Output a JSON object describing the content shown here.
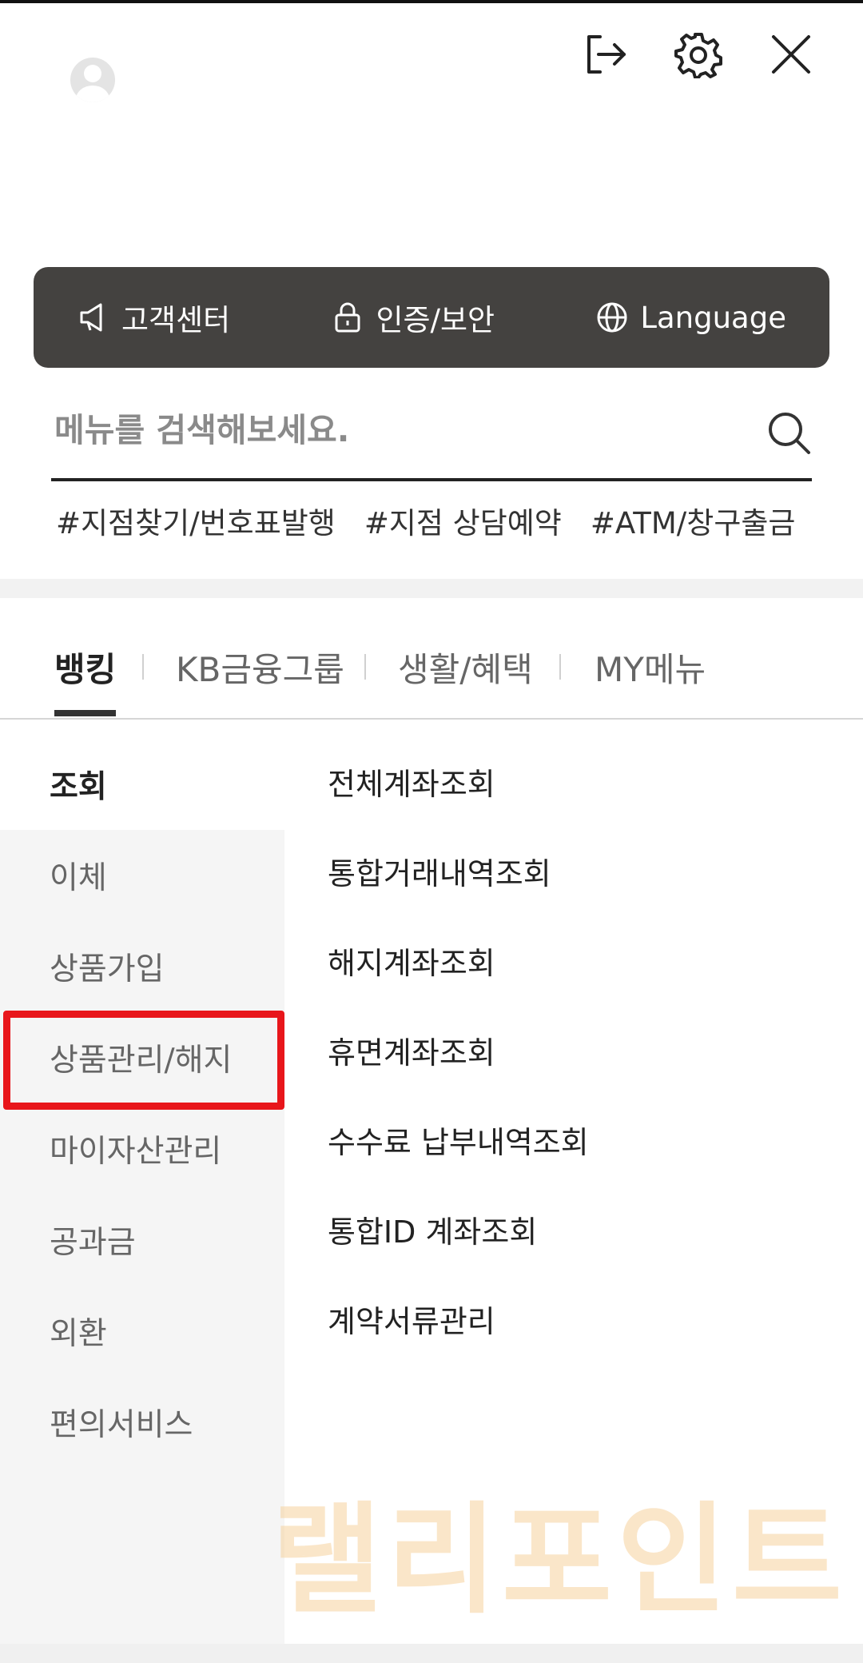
{
  "header": {
    "avatar_icon": "user-avatar-icon",
    "logout_icon": "logout-icon",
    "settings_icon": "gear-icon",
    "close_icon": "close-icon"
  },
  "quickbar": {
    "items": [
      {
        "label": "고객센터",
        "icon": "megaphone-icon"
      },
      {
        "label": "인증/보안",
        "icon": "lock-icon"
      },
      {
        "label": "Language",
        "icon": "globe-icon"
      }
    ]
  },
  "search": {
    "placeholder": "메뉴를 검색해보세요.",
    "icon": "search-icon"
  },
  "tags": [
    "#지점찾기/번호표발행",
    "#지점 상담예약",
    "#ATM/창구출금"
  ],
  "tabs": [
    {
      "label": "뱅킹",
      "active": true
    },
    {
      "label": "KB금융그룹",
      "active": false
    },
    {
      "label": "생활/혜택",
      "active": false
    },
    {
      "label": "MY메뉴",
      "active": false
    }
  ],
  "leftnav": [
    {
      "label": "조회",
      "active": true
    },
    {
      "label": "이체",
      "active": false
    },
    {
      "label": "상품가입",
      "active": false
    },
    {
      "label": "상품관리/해지",
      "active": false,
      "highlighted": true
    },
    {
      "label": "마이자산관리",
      "active": false
    },
    {
      "label": "공과금",
      "active": false
    },
    {
      "label": "외환",
      "active": false
    },
    {
      "label": "편의서비스",
      "active": false
    }
  ],
  "submenu": [
    "전체계좌조회",
    "통합거래내역조회",
    "해지계좌조회",
    "휴면계좌조회",
    "수수료 납부내역조회",
    "통합ID 계좌조회",
    "계약서류관리"
  ],
  "watermark": "랠리포인트",
  "colors": {
    "quickbar_bg": "#444240",
    "highlight": "#e8161b",
    "leftnav_bg": "#f5f5f5"
  }
}
